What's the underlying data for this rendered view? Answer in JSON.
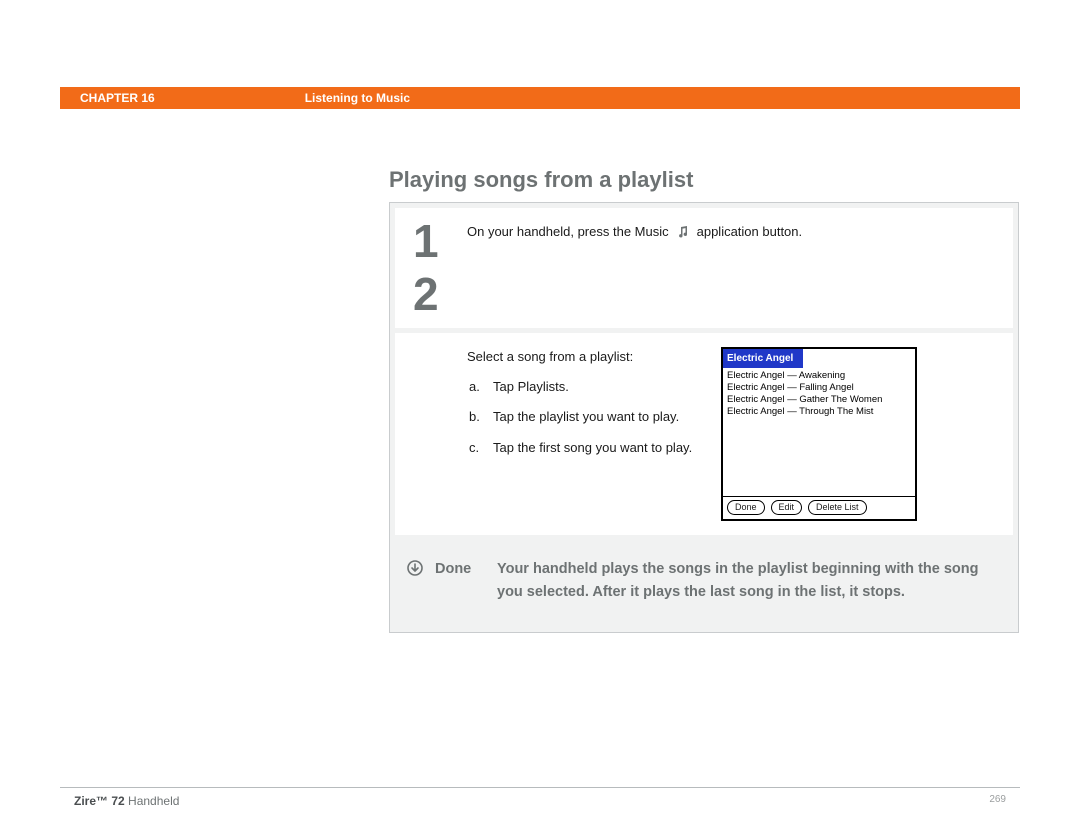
{
  "header": {
    "chapter": "CHAPTER 16",
    "section": "Listening to Music"
  },
  "title": "Playing songs from a playlist",
  "steps": {
    "one": {
      "num": "1",
      "text_a": "On your handheld, press the Music",
      "text_b": "application button."
    },
    "two": {
      "num": "2",
      "intro": "Select a song from a playlist:",
      "a": {
        "bullet": "a.",
        "text": "Tap Playlists."
      },
      "b": {
        "bullet": "b.",
        "text": "Tap the playlist you want to play."
      },
      "c": {
        "bullet": "c.",
        "text": "Tap the first song you want to play."
      }
    }
  },
  "palm": {
    "title": "Electric Angel",
    "items": [
      "Electric Angel — Awakening",
      "Electric Angel — Falling Angel",
      "Electric Angel — Gather The Women",
      "Electric Angel — Through The Mist"
    ],
    "buttons": {
      "done": "Done",
      "edit": "Edit",
      "delete": "Delete List"
    }
  },
  "done": {
    "label": "Done",
    "text": "Your handheld plays the songs in the playlist beginning with the song you selected. After it plays the last song in the list, it stops."
  },
  "footer": {
    "product_bold": "Zire™ 72",
    "product_rest": " Handheld",
    "page": "269"
  }
}
